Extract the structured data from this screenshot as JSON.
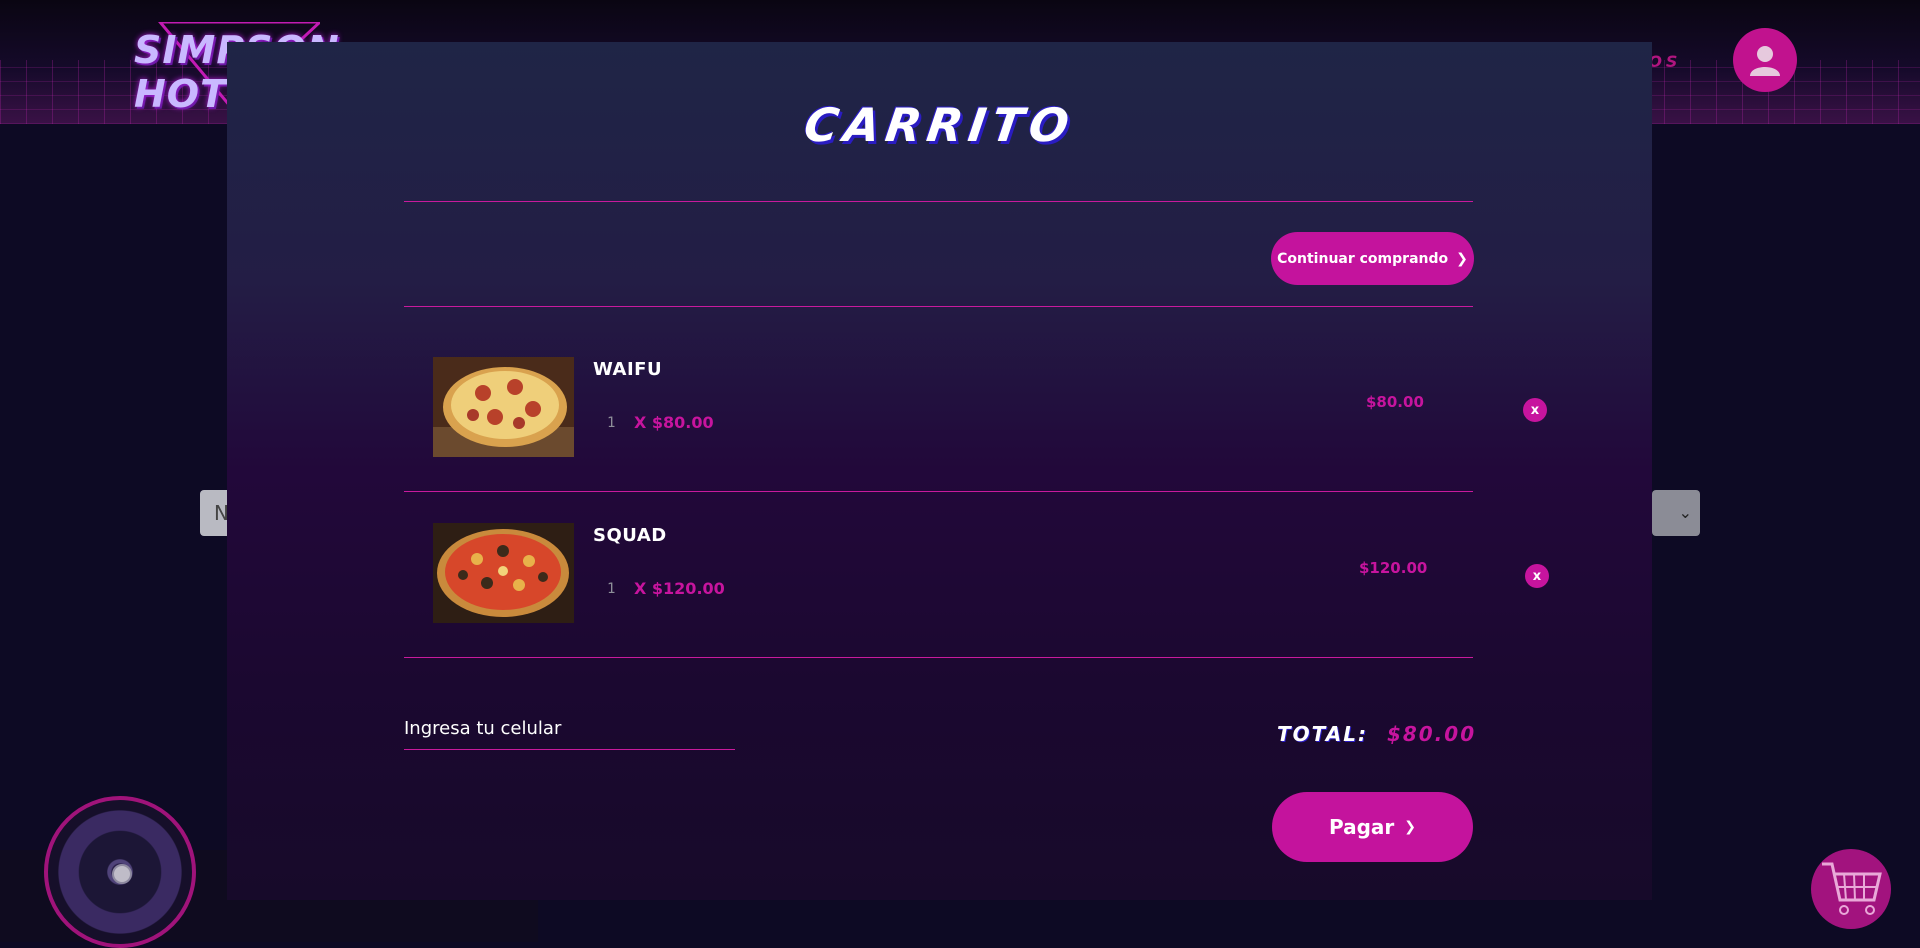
{
  "header": {
    "logo_text": "SIMPSON HOT",
    "nav_partial": "ROS"
  },
  "background": {
    "select_left_partial": "N"
  },
  "cart": {
    "title": "CARRITO",
    "continue_label": "Continuar comprando",
    "items": [
      {
        "name": "WAIFU",
        "quantity": "1",
        "unit_price": "X $80.00",
        "subtotal": "$80.00",
        "remove_label": "x",
        "image": "pizza-pepperoni"
      },
      {
        "name": "SQUAD",
        "quantity": "1",
        "unit_price": "X $120.00",
        "subtotal": "$120.00",
        "remove_label": "x",
        "image": "pizza-supreme"
      }
    ],
    "phone_placeholder": "Ingresa tu celular",
    "total_label": "TOTAL:",
    "total_value": "$80.00",
    "pay_label": "Pagar"
  },
  "colors": {
    "accent": "#c4139d",
    "title_shadow": "#2a1cc2",
    "modal_top": "#1f2546",
    "modal_bottom": "#170a2a"
  }
}
